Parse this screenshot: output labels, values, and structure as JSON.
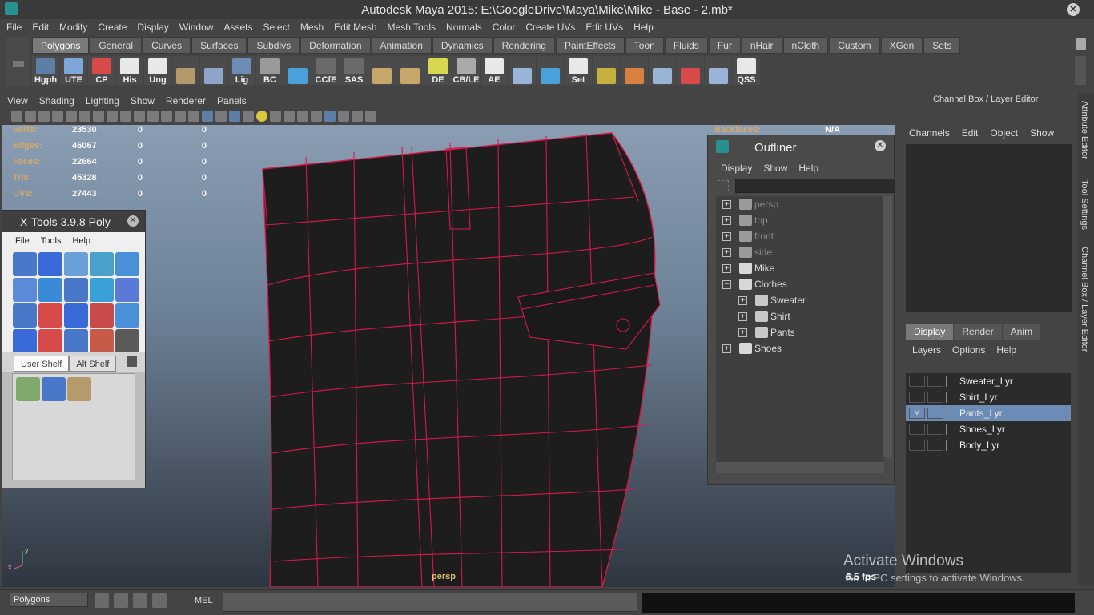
{
  "window": {
    "title": "Autodesk Maya 2015: E:\\GoogleDrive\\Maya\\Mike\\Mike - Base - 2.mb*"
  },
  "menubar": [
    "File",
    "Edit",
    "Modify",
    "Create",
    "Display",
    "Window",
    "Assets",
    "Select",
    "Mesh",
    "Edit Mesh",
    "Mesh Tools",
    "Normals",
    "Color",
    "Create UVs",
    "Edit UVs",
    "Help"
  ],
  "shelf": {
    "tabs": [
      "Polygons",
      "General",
      "Curves",
      "Surfaces",
      "Subdivs",
      "Deformation",
      "Animation",
      "Dynamics",
      "Rendering",
      "PaintEffects",
      "Toon",
      "Fluids",
      "Fur",
      "nHair",
      "nCloth",
      "Custom",
      "XGen",
      "Sets"
    ],
    "active_tab": "Polygons",
    "icons": [
      "Hgph",
      "UTE",
      "CP",
      "His",
      "Ung",
      "",
      "",
      "Lig",
      "BC",
      "",
      "CCfE",
      "SAS",
      "",
      "",
      "DE",
      "CB/LE",
      "AE",
      "",
      "",
      "Set",
      "",
      "",
      "",
      "",
      "",
      "QSS"
    ]
  },
  "viewport": {
    "menu": [
      "View",
      "Shading",
      "Lighting",
      "Show",
      "Renderer",
      "Panels"
    ],
    "hud": [
      {
        "label": "Verts:",
        "v1": "23530",
        "v2": "0",
        "v3": "0"
      },
      {
        "label": "Edges:",
        "v1": "46067",
        "v2": "0",
        "v3": "0"
      },
      {
        "label": "Faces:",
        "v1": "22664",
        "v2": "0",
        "v3": "0"
      },
      {
        "label": "Tris:",
        "v1": "45328",
        "v2": "0",
        "v3": "0"
      },
      {
        "label": "UVs:",
        "v1": "27443",
        "v2": "0",
        "v3": "0"
      }
    ],
    "backfaces_label": "Backfaces:",
    "backfaces_value": "N/A",
    "camera": "persp",
    "fps": "6.5 fps",
    "axis_y": "y",
    "axis_x": "x"
  },
  "xtools": {
    "title": "X-Tools 3.9.8 Poly",
    "menu": [
      "File",
      "Tools",
      "Help"
    ],
    "shelf_tabs": [
      "User Shelf",
      "Alt Shelf"
    ]
  },
  "outliner": {
    "title": "Outliner",
    "menu": [
      "Display",
      "Show",
      "Help"
    ],
    "nodes": [
      {
        "name": "persp",
        "depth": 0,
        "pm": "+",
        "dim": true,
        "type": "camera"
      },
      {
        "name": "top",
        "depth": 0,
        "pm": "+",
        "dim": true,
        "type": "camera"
      },
      {
        "name": "front",
        "depth": 0,
        "pm": "+",
        "dim": true,
        "type": "camera"
      },
      {
        "name": "side",
        "depth": 0,
        "pm": "+",
        "dim": true,
        "type": "camera"
      },
      {
        "name": "Mike",
        "depth": 0,
        "pm": "+",
        "dim": false,
        "type": "group"
      },
      {
        "name": "Clothes",
        "depth": 0,
        "pm": "−",
        "dim": false,
        "type": "group"
      },
      {
        "name": "Sweater",
        "depth": 1,
        "pm": "+",
        "dim": false,
        "type": "mesh"
      },
      {
        "name": "Shirt",
        "depth": 1,
        "pm": "+",
        "dim": false,
        "type": "mesh"
      },
      {
        "name": "Pants",
        "depth": 1,
        "pm": "+",
        "dim": false,
        "type": "mesh"
      },
      {
        "name": "Shoes",
        "depth": 0,
        "pm": "+",
        "dim": false,
        "type": "group"
      }
    ]
  },
  "channelbox": {
    "title": "Channel Box / Layer Editor",
    "menu": [
      "Channels",
      "Edit",
      "Object",
      "Show"
    ],
    "layer_tabs": [
      "Display",
      "Render",
      "Anim"
    ],
    "layer_menu": [
      "Layers",
      "Options",
      "Help"
    ],
    "layers": [
      {
        "name": "Sweater_Lyr",
        "v": "",
        "selected": false
      },
      {
        "name": "Shirt_Lyr",
        "v": "",
        "selected": false
      },
      {
        "name": "Pants_Lyr",
        "v": "V",
        "selected": true
      },
      {
        "name": "Shoes_Lyr",
        "v": "",
        "selected": false
      },
      {
        "name": "Body_Lyr",
        "v": "",
        "selected": false
      }
    ]
  },
  "sidetabs": [
    "Attribute Editor",
    "Tool Settings",
    "Channel Box / Layer Editor"
  ],
  "statusline": {
    "select_mode": "Polygons",
    "mel_label": "MEL"
  },
  "watermark": {
    "line1": "Activate Windows",
    "line2": "Go to PC settings to activate Windows."
  },
  "colors": {
    "wire": "#d8184a",
    "mesh": "#1e1e1e",
    "selection": "#6d8cb5",
    "hud_label": "#d7a96b"
  }
}
